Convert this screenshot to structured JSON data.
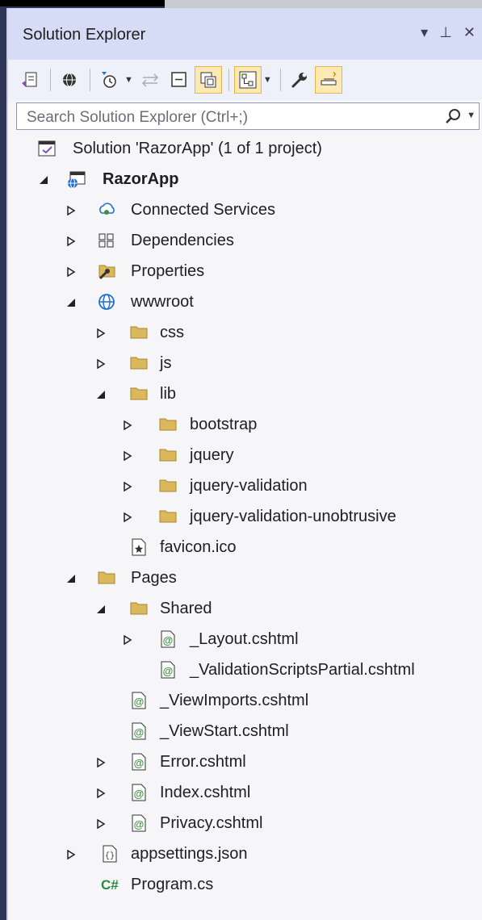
{
  "window": {
    "title": "Solution Explorer",
    "dropdown_glyph": "▾",
    "pin_glyph": "⊥",
    "close_glyph": "✕"
  },
  "search": {
    "placeholder": "Search Solution Explorer (Ctrl+;)"
  },
  "tree": {
    "solution": "Solution 'RazorApp' (1 of 1 project)",
    "project": "RazorApp",
    "connected_services": "Connected Services",
    "dependencies": "Dependencies",
    "properties": "Properties",
    "wwwroot": "wwwroot",
    "css": "css",
    "js": "js",
    "lib": "lib",
    "bootstrap": "bootstrap",
    "jquery": "jquery",
    "jquery_validation": "jquery-validation",
    "jquery_validation_unobtrusive": "jquery-validation-unobtrusive",
    "favicon": "favicon.ico",
    "pages": "Pages",
    "shared": "Shared",
    "layout": "_Layout.cshtml",
    "validation_partial": "_ValidationScriptsPartial.cshtml",
    "viewimports": "_ViewImports.cshtml",
    "viewstart": "_ViewStart.cshtml",
    "error": "Error.cshtml",
    "index": "Index.cshtml",
    "privacy": "Privacy.cshtml",
    "appsettings": "appsettings.json",
    "program": "Program.cs",
    "csharp_badge": "C#",
    "razor_badge": "@",
    "json_badge": "{}"
  },
  "colors": {
    "accent": "#d6dbf6",
    "folder": "#dcb85c",
    "razor": "#3f9142",
    "selected_tool": "#fde9b3"
  }
}
